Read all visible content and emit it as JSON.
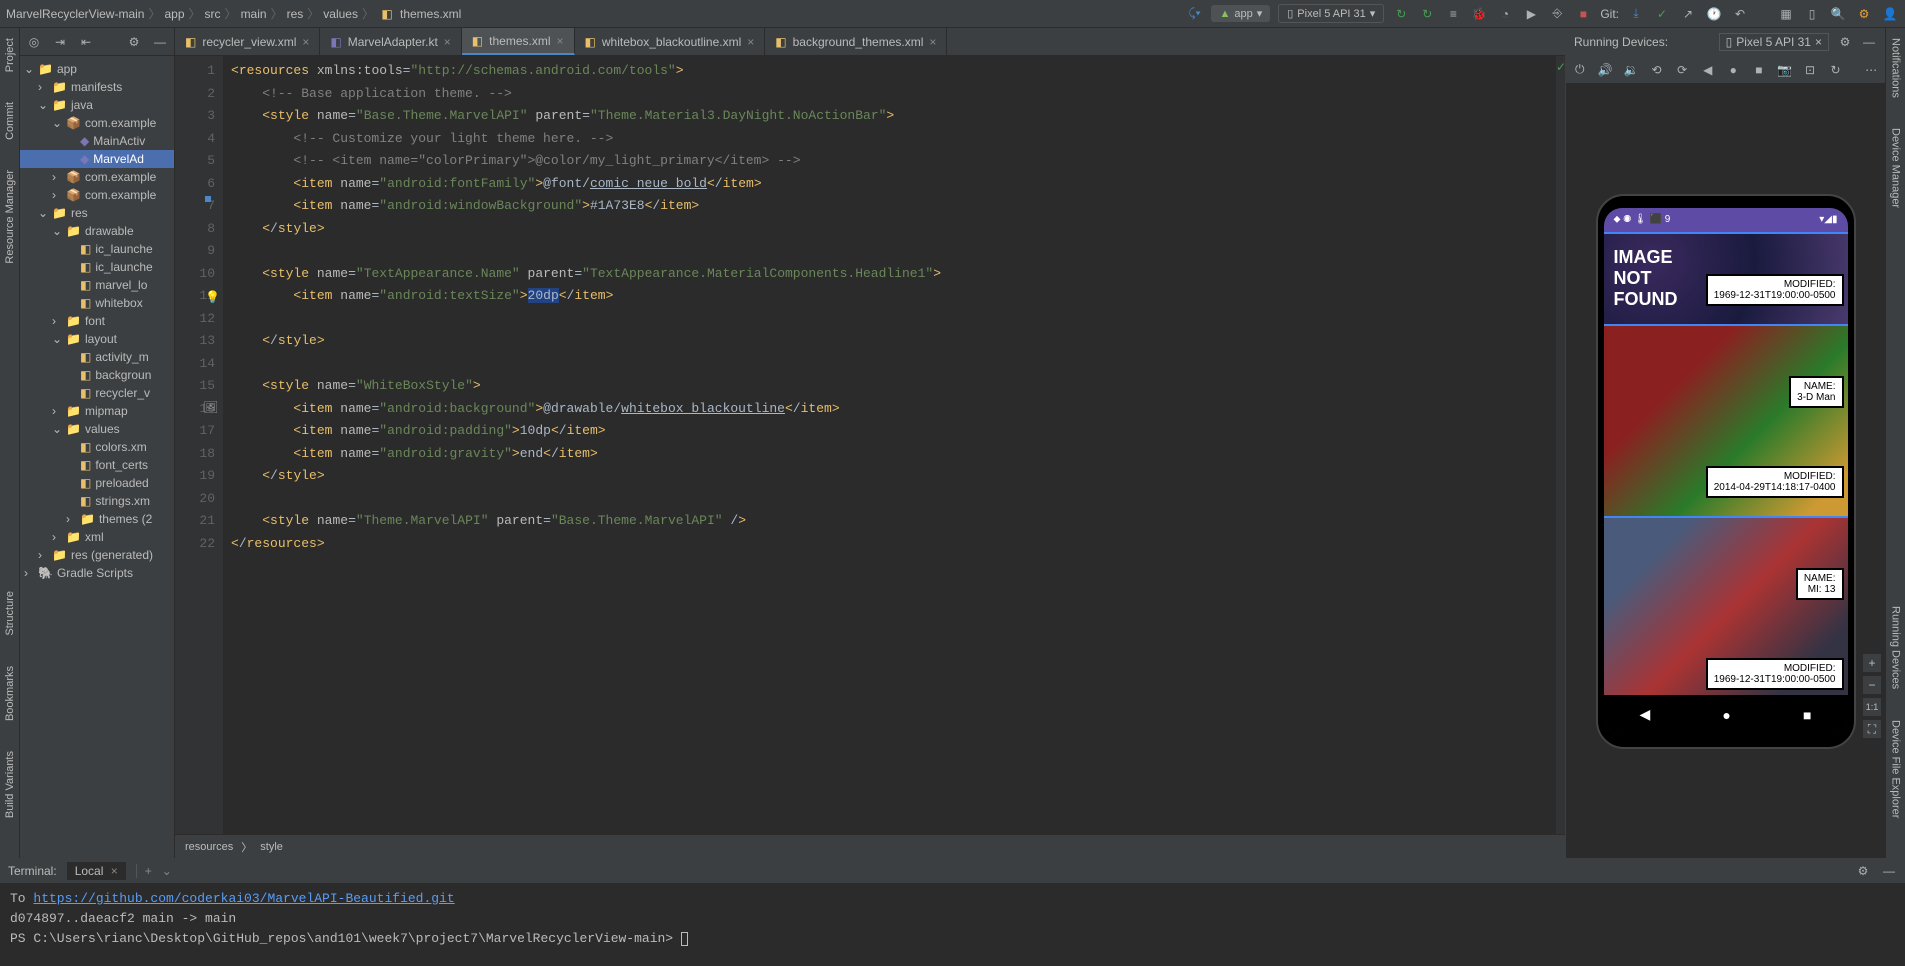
{
  "breadcrumb": [
    "MarvelRecyclerView-main",
    "app",
    "src",
    "main",
    "res",
    "values",
    "themes.xml"
  ],
  "toolbar": {
    "config": "app",
    "device": "Pixel 5 API 31",
    "git_label": "Git:"
  },
  "project_tree": {
    "root": "app",
    "items": [
      {
        "depth": 0,
        "icon": "app",
        "label": "app",
        "chev": "v"
      },
      {
        "depth": 1,
        "icon": "folder",
        "label": "manifests",
        "chev": ">"
      },
      {
        "depth": 1,
        "icon": "folder",
        "label": "java",
        "chev": "v"
      },
      {
        "depth": 2,
        "icon": "pkg",
        "label": "com.example",
        "chev": "v"
      },
      {
        "depth": 3,
        "icon": "kt",
        "label": "MainActiv"
      },
      {
        "depth": 3,
        "icon": "kt",
        "label": "MarvelAd",
        "selected": true
      },
      {
        "depth": 2,
        "icon": "pkg",
        "label": "com.example",
        "chev": ">"
      },
      {
        "depth": 2,
        "icon": "pkg",
        "label": "com.example",
        "chev": ">"
      },
      {
        "depth": 1,
        "icon": "folder",
        "label": "res",
        "chev": "v"
      },
      {
        "depth": 2,
        "icon": "folder",
        "label": "drawable",
        "chev": "v"
      },
      {
        "depth": 3,
        "icon": "xml",
        "label": "ic_launche"
      },
      {
        "depth": 3,
        "icon": "xml",
        "label": "ic_launche"
      },
      {
        "depth": 3,
        "icon": "xml",
        "label": "marvel_lo"
      },
      {
        "depth": 3,
        "icon": "xml",
        "label": "whitebox"
      },
      {
        "depth": 2,
        "icon": "folder",
        "label": "font",
        "chev": ">"
      },
      {
        "depth": 2,
        "icon": "folder",
        "label": "layout",
        "chev": "v"
      },
      {
        "depth": 3,
        "icon": "xml",
        "label": "activity_m"
      },
      {
        "depth": 3,
        "icon": "xml",
        "label": "backgroun"
      },
      {
        "depth": 3,
        "icon": "xml",
        "label": "recycler_v"
      },
      {
        "depth": 2,
        "icon": "folder",
        "label": "mipmap",
        "chev": ">"
      },
      {
        "depth": 2,
        "icon": "folder",
        "label": "values",
        "chev": "v"
      },
      {
        "depth": 3,
        "icon": "xml",
        "label": "colors.xm"
      },
      {
        "depth": 3,
        "icon": "xml",
        "label": "font_certs"
      },
      {
        "depth": 3,
        "icon": "xml",
        "label": "preloaded"
      },
      {
        "depth": 3,
        "icon": "xml",
        "label": "strings.xm"
      },
      {
        "depth": 3,
        "icon": "folder",
        "label": "themes (2",
        "chev": ">"
      },
      {
        "depth": 2,
        "icon": "folder",
        "label": "xml",
        "chev": ">"
      },
      {
        "depth": 1,
        "icon": "folder",
        "label": "res (generated)",
        "chev": ">"
      },
      {
        "depth": 0,
        "icon": "gradle",
        "label": "Gradle Scripts",
        "chev": ">"
      }
    ]
  },
  "editor_tabs": [
    {
      "label": "recycler_view.xml",
      "icon": "xml"
    },
    {
      "label": "MarvelAdapter.kt",
      "icon": "kt"
    },
    {
      "label": "themes.xml",
      "icon": "xml",
      "active": true
    },
    {
      "label": "whitebox_blackoutline.xml",
      "icon": "xml"
    },
    {
      "label": "background_themes.xml",
      "icon": "xml"
    }
  ],
  "code_lines": [
    "<resources xmlns:tools=\"http://schemas.android.com/tools\">",
    "    <!-- Base application theme. -->",
    "    <style name=\"Base.Theme.MarvelAPI\" parent=\"Theme.Material3.DayNight.NoActionBar\">",
    "        <!-- Customize your light theme here. -->",
    "        <!-- <item name=\"colorPrimary\">@color/my_light_primary</item> -->",
    "        <item name=\"android:fontFamily\">@font/comic_neue_bold</item>",
    "        <item name=\"android:windowBackground\">#1A73E8</item>",
    "    </style>",
    "",
    "    <style name=\"TextAppearance.Name\" parent=\"TextAppearance.MaterialComponents.Headline1\">",
    "        <item name=\"android:textSize\">20dp</item>",
    "",
    "    </style>",
    "",
    "    <style name=\"WhiteBoxStyle\">",
    "        <item name=\"android:background\">@drawable/whitebox_blackoutline</item>",
    "        <item name=\"android:padding\">10dp</item>",
    "        <item name=\"android:gravity\">end</item>",
    "    </style>",
    "",
    "    <style name=\"Theme.MarvelAPI\" parent=\"Base.Theme.MarvelAPI\" />",
    "</resources>"
  ],
  "line_numbers": [
    1,
    2,
    3,
    4,
    5,
    6,
    7,
    8,
    9,
    10,
    11,
    12,
    13,
    14,
    15,
    16,
    17,
    18,
    19,
    20,
    21,
    22
  ],
  "breadcrumb_footer": [
    "resources",
    "style"
  ],
  "running_devices": {
    "label": "Running Devices:",
    "device": "Pixel 5 API 31"
  },
  "phone": {
    "status_left": "⬥ ◉ 🌡 ⬛ 9",
    "status_right": "▾◢▮",
    "placeholder": [
      "IMAGE",
      "NOT",
      "FOUND"
    ],
    "card1_mod_label": "MODIFIED:",
    "card1_mod_val": "1969-12-31T19:00:00-0500",
    "card2_name_label": "NAME:",
    "card2_name_val": "3-D Man",
    "card2_mod_label": "MODIFIED:",
    "card2_mod_val": "2014-04-29T14:18:17-0400",
    "card3_name_label": "NAME:",
    "card3_name_val": "MI: 13",
    "card3_mod_label": "MODIFIED:",
    "card3_mod_val": "1969-12-31T19:00:00-0500"
  },
  "terminal": {
    "tab_label": "Terminal:",
    "tab_local": "Local",
    "lines": {
      "to": "To ",
      "url": "https://github.com/coderkai03/MarvelAPI-Beautified.git",
      "push": "   d074897..daeacf2  main -> main",
      "prompt": "PS C:\\Users\\rianc\\Desktop\\GitHub_repos\\and101\\week7\\project7\\MarvelRecyclerView-main> "
    }
  },
  "left_sidebar": [
    "Project",
    "Commit",
    "Resource Manager"
  ],
  "left_sidebar2": [
    "Structure",
    "Bookmarks",
    "Build Variants"
  ],
  "right_sidebar": [
    "Notifications",
    "Device Manager",
    "Running Devices",
    "Device File Explorer"
  ]
}
